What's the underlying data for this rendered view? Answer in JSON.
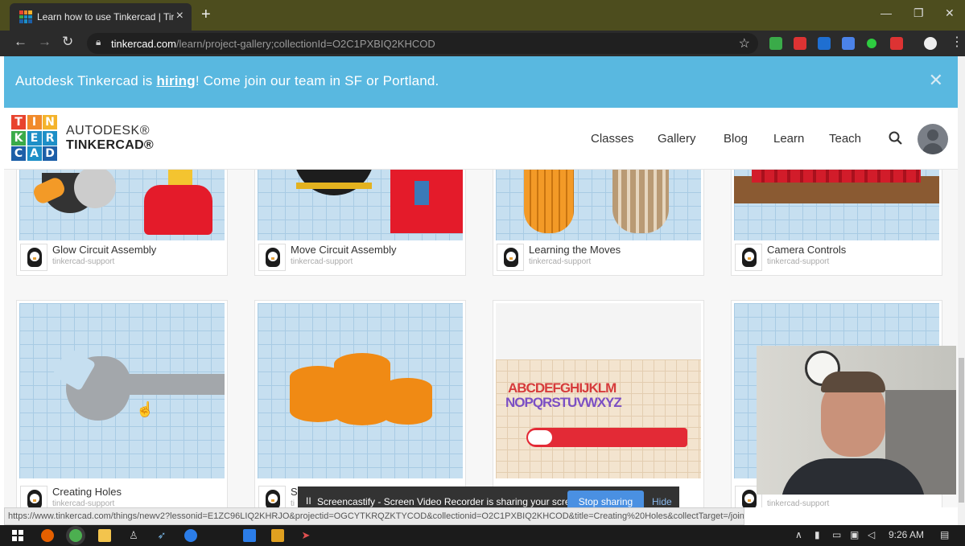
{
  "browser": {
    "tab_title": "Learn how to use Tinkercad | Tinl",
    "new_tab": "+",
    "url_host": "tinkercad.com",
    "url_path": "/learn/project-gallery;collectionId=O2C1PXBIQ2KHCOD",
    "window": {
      "minimize": "—",
      "restore": "❐",
      "close": "✕"
    }
  },
  "banner": {
    "prefix": "Autodesk Tinkercad is ",
    "link": "hiring",
    "suffix": "! Come join our team in SF or Portland.",
    "close": "✕"
  },
  "header": {
    "logo_letters": [
      "T",
      "I",
      "N",
      "K",
      "E",
      "R",
      "C",
      "A",
      "D"
    ],
    "logo_colors": [
      "#e8432e",
      "#f18a2b",
      "#f4b32b",
      "#3aab49",
      "#1d8fc7",
      "#1d8fc7",
      "#1d5fa8",
      "#1d8fc7",
      "#1d5fa8"
    ],
    "brand_top": "AUTODESK®",
    "brand_bottom": "TINKERCAD®",
    "nav": {
      "classes": "Classes",
      "gallery": "Gallery",
      "blog": "Blog",
      "learn": "Learn",
      "teach": "Teach"
    }
  },
  "gallery": {
    "cards": [
      {
        "name": "Glow Circuit Assembly",
        "author": "tinkercad-support"
      },
      {
        "name": "Move Circuit Assembly",
        "author": "tinkercad-support"
      },
      {
        "name": "Learning the Moves",
        "author": "tinkercad-support"
      },
      {
        "name": "Camera Controls",
        "author": "tinkercad-support"
      },
      {
        "name": "Creating Holes",
        "author": "tinkercad-support"
      },
      {
        "name": "S",
        "author": "ti"
      },
      {
        "name": "",
        "author": ""
      },
      {
        "name": "",
        "author": "tinkercad-support"
      }
    ],
    "letters_row1": "ABCDEFGHIJKLM",
    "letters_row2": "NOPQRSTUVWXYZ"
  },
  "screencastify": {
    "pause": "II",
    "message": "Screencastify - Screen Video Recorder is sharing your screen.",
    "stop": "Stop sharing",
    "hide": "Hide"
  },
  "status_url": "https://www.tinkercad.com/things/newv2?lessonid=E1ZC96LIQ2KHRJO&projectid=OGCYTKRQZKTYCOD&collectionid=O2C1PXBIQ2KHCOD&title=Creating%20Holes&collectTarget=/join",
  "taskbar": {
    "time": "9:26 AM"
  }
}
